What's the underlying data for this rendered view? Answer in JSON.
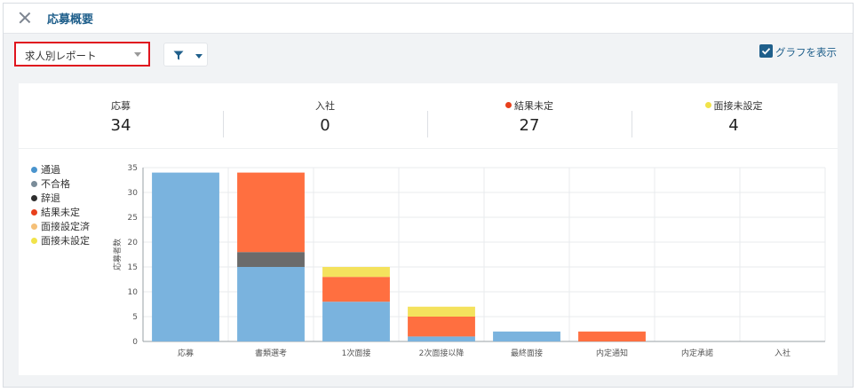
{
  "window": {
    "title": "応募概要"
  },
  "controls": {
    "report_select": "求人別レポート",
    "toggle_label": "グラフを表示"
  },
  "stats": [
    {
      "label": "応募",
      "value": "34"
    },
    {
      "label": "入社",
      "value": "0"
    },
    {
      "label": "結果未定",
      "value": "27",
      "dot_color": "#e8401c"
    },
    {
      "label": "面接未設定",
      "value": "4",
      "dot_color": "#f1e34a"
    }
  ],
  "legend": [
    {
      "label": "通過",
      "color": "#4a94cd"
    },
    {
      "label": "不合格",
      "color": "#7a8c99"
    },
    {
      "label": "辞退",
      "color": "#2e2e2e"
    },
    {
      "label": "結果未定",
      "color": "#e8401c"
    },
    {
      "label": "面接設定済",
      "color": "#f5c078"
    },
    {
      "label": "面接未設定",
      "color": "#f1e34a"
    }
  ],
  "chart_data": {
    "type": "bar",
    "stacked": true,
    "ylabel": "応募者数",
    "ylim": [
      0,
      35
    ],
    "yticks": [
      0,
      5,
      10,
      15,
      20,
      25,
      30,
      35
    ],
    "grid": true,
    "legend_position": "left",
    "categories": [
      "応募",
      "書類選考",
      "1次面接",
      "2次面接以降",
      "最終面接",
      "内定通知",
      "内定承諾",
      "入社"
    ],
    "series": [
      {
        "name": "通過",
        "color": "#7ab3de",
        "values": [
          34,
          15,
          8,
          1,
          2,
          0,
          0,
          0
        ]
      },
      {
        "name": "不合格",
        "color": "#7a8c99",
        "values": [
          0,
          0,
          0,
          0,
          0,
          0,
          0,
          0
        ]
      },
      {
        "name": "辞退",
        "color": "#6b6b6b",
        "values": [
          0,
          3,
          0,
          0,
          0,
          0,
          0,
          0
        ]
      },
      {
        "name": "結果未定",
        "color": "#ff6f40",
        "values": [
          0,
          16,
          5,
          4,
          0,
          2,
          0,
          0
        ]
      },
      {
        "name": "面接設定済",
        "color": "#f5c078",
        "values": [
          0,
          0,
          0,
          0,
          0,
          0,
          0,
          0
        ]
      },
      {
        "name": "面接未設定",
        "color": "#f4e25d",
        "values": [
          0,
          0,
          2,
          2,
          0,
          0,
          0,
          0
        ]
      }
    ]
  }
}
